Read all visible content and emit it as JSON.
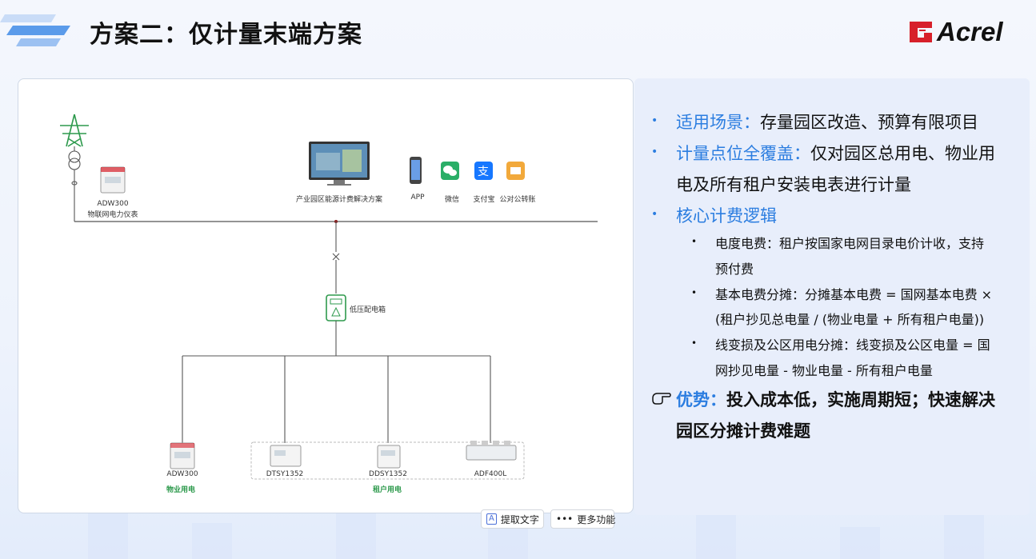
{
  "page": {
    "title": "方案二：仅计量末端方案",
    "brand": "Acrel"
  },
  "diagram": {
    "top_meter": {
      "model": "ADW300",
      "desc": "物联网电力仪表"
    },
    "platform_label": "产业园区能源计费解决方案",
    "channels": [
      "APP",
      "微信",
      "支付宝",
      "公对公转账"
    ],
    "distribution_box": "低压配电箱",
    "meters": [
      {
        "model": "ADW300"
      },
      {
        "model": "DTSY1352"
      },
      {
        "model": "DDSY1352"
      },
      {
        "model": "ADF400L"
      }
    ],
    "group_property": "物业用电",
    "group_tenant": "租户用电"
  },
  "info": {
    "scene_label": "适用场景：",
    "scene_text": "存量园区改造、预算有限项目",
    "coverage_label": "计量点位全覆盖：",
    "coverage_text1": "仅对园区总用电、物业用",
    "coverage_text2": "电及所有租户安装电表进行计量",
    "logic_label": "核心计费逻辑",
    "sub1_line1": "电度电费：租户按国家电网目录电价计收，支持",
    "sub1_line2": "预付费",
    "sub2_line1": "基本电费分摊：分摊基本电费 = 国网基本电费 ×",
    "sub2_line2": "(租户抄见总电量 / (物业电量 + 所有租户电量))",
    "sub3_line1": "线变损及公区用电分摊：线变损及公区电量 = 国",
    "sub3_line2": "网抄见电量 - 物业电量 - 所有租户电量",
    "adv_label": "优势：",
    "adv_text1": "投入成本低，实施周期短；快速解决",
    "adv_text2": "园区分摊计费难题"
  },
  "toolbar": {
    "extract_text": "提取文字",
    "more": "更多功能"
  },
  "colors": {
    "accent": "#2b7de0",
    "green": "#2e9a4d",
    "brand_red": "#d7202a"
  }
}
